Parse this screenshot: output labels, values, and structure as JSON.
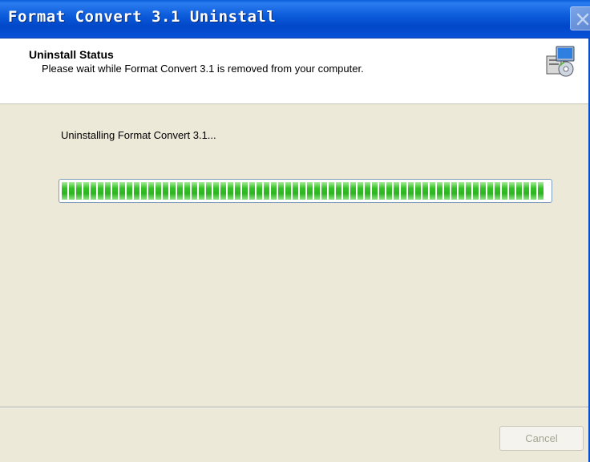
{
  "window": {
    "title": "Format Convert 3.1 Uninstall"
  },
  "header": {
    "title": "Uninstall Status",
    "subtitle": "Please wait while Format Convert 3.1 is removed from your computer."
  },
  "main": {
    "status_text": "Uninstalling Format Convert 3.1...",
    "progress_percent": 100
  },
  "footer": {
    "cancel_label": "Cancel"
  },
  "colors": {
    "titlebar": "#0d5ddc",
    "progress_fill": "#35c027",
    "dialog_bg": "#ece9d8"
  },
  "icons": {
    "close": "close-icon",
    "installer": "installer-icon"
  }
}
